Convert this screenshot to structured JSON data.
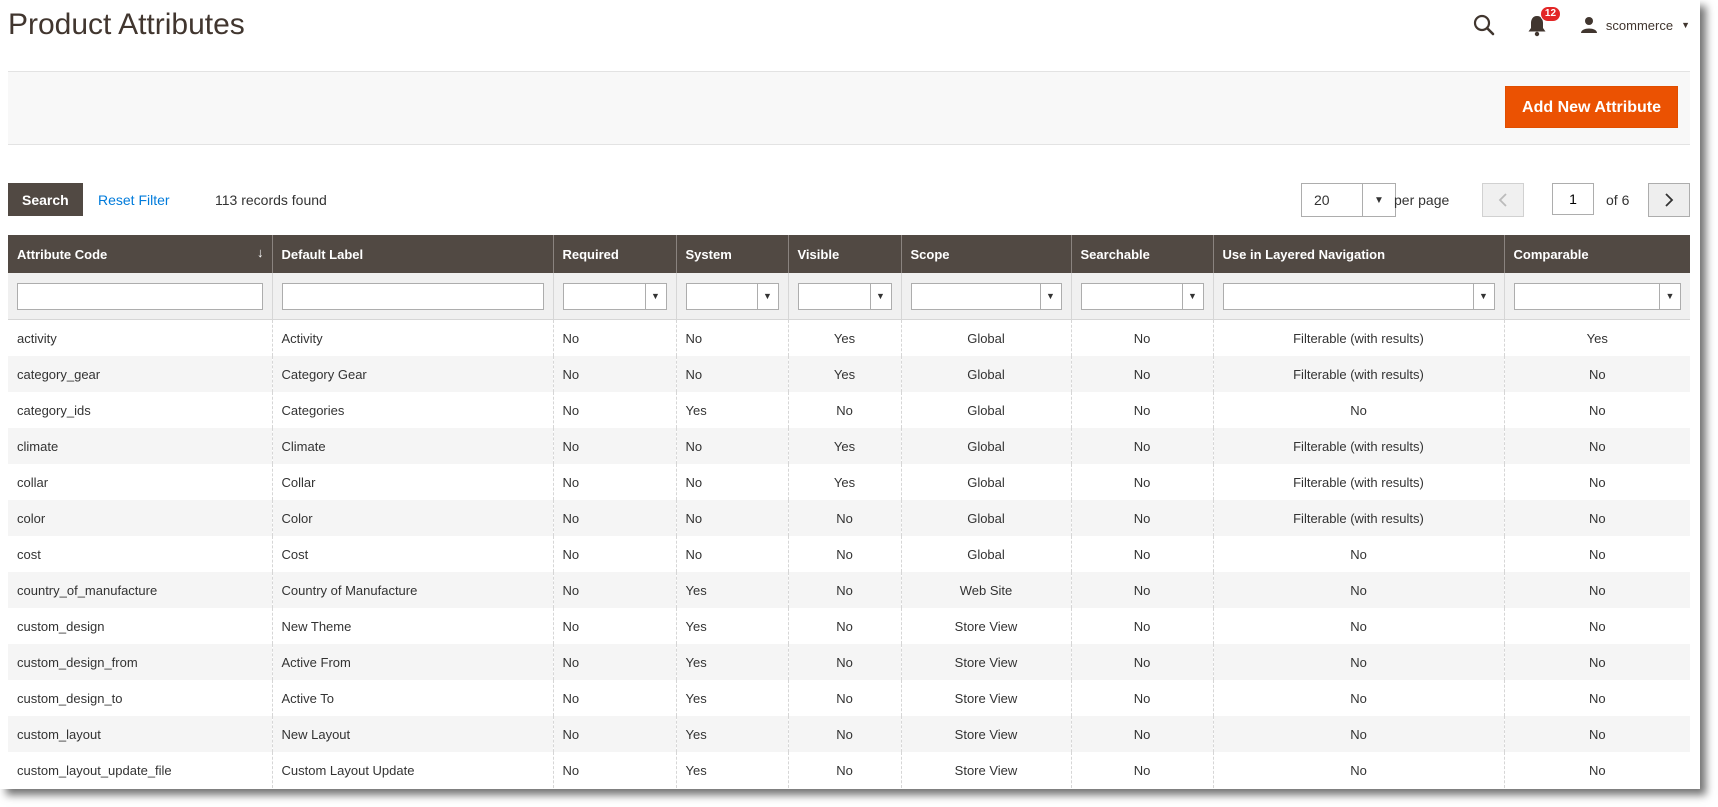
{
  "header": {
    "title": "Product Attributes",
    "notification_count": "12",
    "username": "scommerce"
  },
  "actions": {
    "add_new_attribute_label": "Add New Attribute"
  },
  "toolbar": {
    "search_label": "Search",
    "reset_filter_label": "Reset Filter",
    "records_found": "113 records found",
    "per_page_value": "20",
    "per_page_label": "per page",
    "current_page": "1",
    "page_of": "of 6"
  },
  "columns": [
    "Attribute Code",
    "Default Label",
    "Required",
    "System",
    "Visible",
    "Scope",
    "Searchable",
    "Use in Layered Navigation",
    "Comparable"
  ],
  "rows": [
    [
      "activity",
      "Activity",
      "No",
      "No",
      "Yes",
      "Global",
      "No",
      "Filterable (with results)",
      "Yes"
    ],
    [
      "category_gear",
      "Category Gear",
      "No",
      "No",
      "Yes",
      "Global",
      "No",
      "Filterable (with results)",
      "No"
    ],
    [
      "category_ids",
      "Categories",
      "No",
      "Yes",
      "No",
      "Global",
      "No",
      "No",
      "No"
    ],
    [
      "climate",
      "Climate",
      "No",
      "No",
      "Yes",
      "Global",
      "No",
      "Filterable (with results)",
      "No"
    ],
    [
      "collar",
      "Collar",
      "No",
      "No",
      "Yes",
      "Global",
      "No",
      "Filterable (with results)",
      "No"
    ],
    [
      "color",
      "Color",
      "No",
      "No",
      "No",
      "Global",
      "No",
      "Filterable (with results)",
      "No"
    ],
    [
      "cost",
      "Cost",
      "No",
      "No",
      "No",
      "Global",
      "No",
      "No",
      "No"
    ],
    [
      "country_of_manufacture",
      "Country of Manufacture",
      "No",
      "Yes",
      "No",
      "Web Site",
      "No",
      "No",
      "No"
    ],
    [
      "custom_design",
      "New Theme",
      "No",
      "Yes",
      "No",
      "Store View",
      "No",
      "No",
      "No"
    ],
    [
      "custom_design_from",
      "Active From",
      "No",
      "Yes",
      "No",
      "Store View",
      "No",
      "No",
      "No"
    ],
    [
      "custom_design_to",
      "Active To",
      "No",
      "Yes",
      "No",
      "Store View",
      "No",
      "No",
      "No"
    ],
    [
      "custom_layout",
      "New Layout",
      "No",
      "Yes",
      "No",
      "Store View",
      "No",
      "No",
      "No"
    ],
    [
      "custom_layout_update_file",
      "Custom Layout Update",
      "No",
      "Yes",
      "No",
      "Store View",
      "No",
      "No",
      "No"
    ]
  ],
  "colors": {
    "accent": "#eb5202",
    "header_bg": "#514943",
    "link": "#007bdb"
  }
}
